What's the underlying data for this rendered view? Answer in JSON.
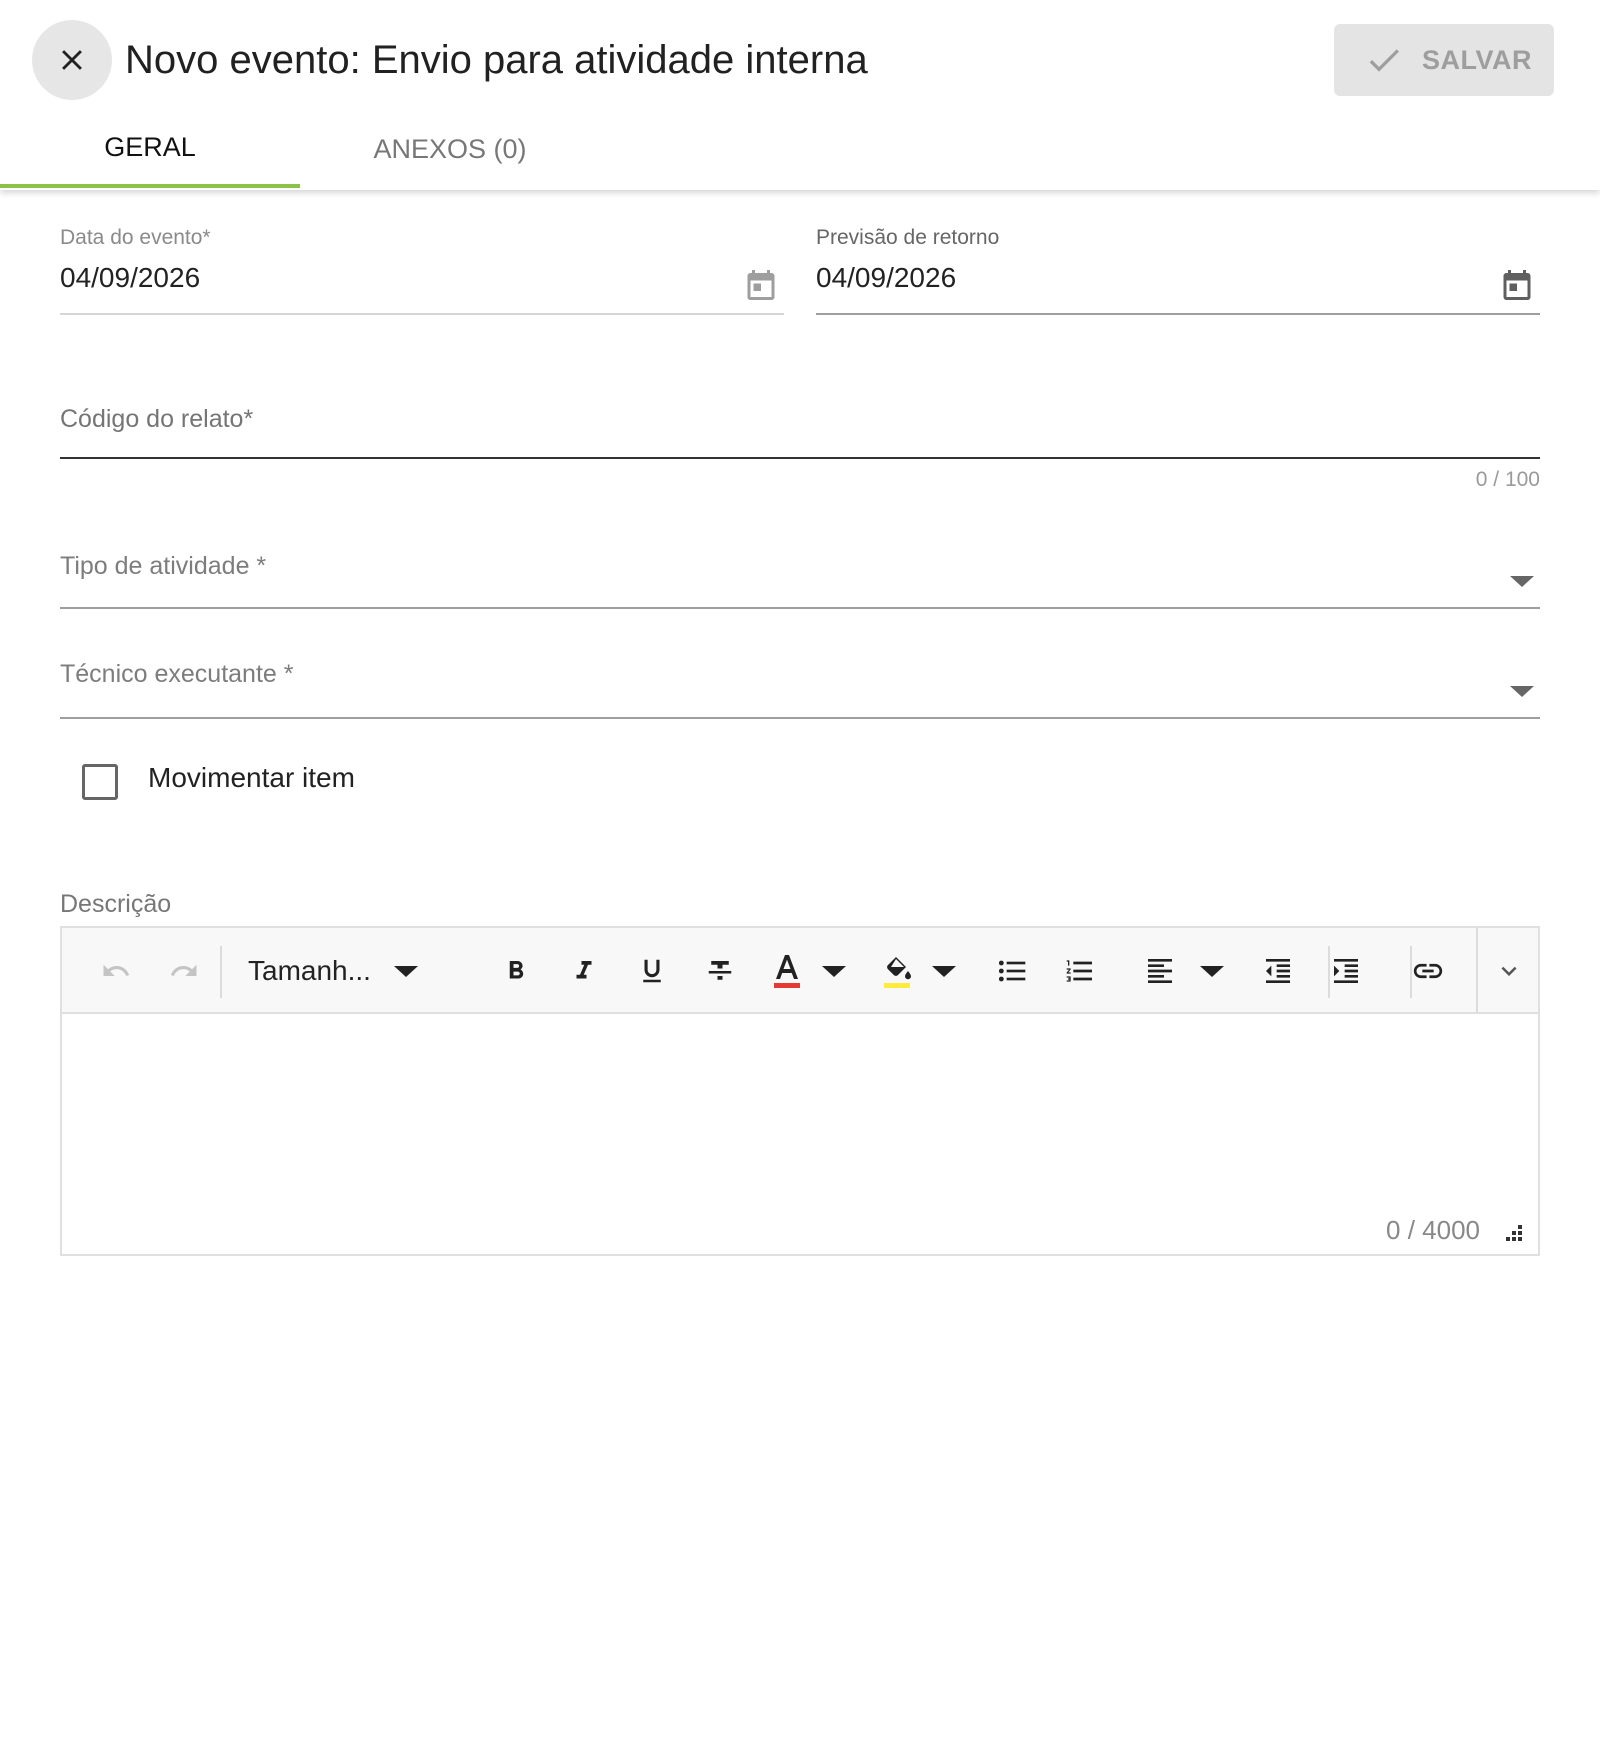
{
  "header": {
    "title": "Novo evento: Envio para atividade interna",
    "save_label": "SALVAR"
  },
  "tabs": [
    {
      "label": "GERAL",
      "active": true
    },
    {
      "label": "ANEXOS (0)",
      "active": false
    }
  ],
  "form": {
    "event_date": {
      "label": "Data do evento*",
      "value": "04/09/2026"
    },
    "return_date": {
      "label": "Previsão de retorno",
      "value": "04/09/2026"
    },
    "report_code": {
      "label": "Código do relato*",
      "value": "",
      "counter": "0 / 100"
    },
    "activity_type": {
      "label": "Tipo de atividade *",
      "value": ""
    },
    "technician": {
      "label": "Técnico executante *",
      "value": ""
    },
    "move_item": {
      "label": "Movimentar item",
      "checked": false
    }
  },
  "editor": {
    "label": "Descrição",
    "font_size_label": "Tamanh...",
    "counter": "0 / 4000",
    "text_color": "#e53935",
    "highlight_color": "#ffeb3b"
  },
  "colors": {
    "tab_accent": "#8bc34a"
  }
}
